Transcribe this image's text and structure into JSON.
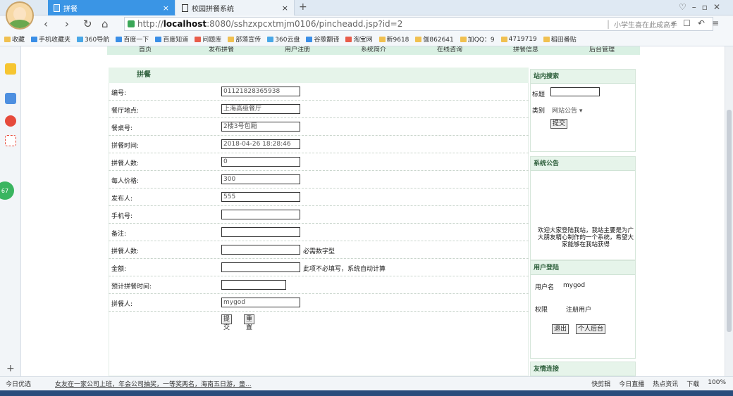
{
  "browser": {
    "tab_active": "拼餐",
    "tab_inactive": "校园拼餐系统",
    "url_protocol": "http://",
    "url_host": "localhost",
    "url_rest": ":8080/sshzxpcxtmjm0106/pincheadd.jsp?id=2",
    "search_hint": "小学生喜在此成高手",
    "favorites": [
      "收藏",
      "手机收藏夹",
      "360导航",
      "百度一下",
      "百度知道",
      "问题库",
      "部落宣传",
      "360云盘",
      "谷歌翻译",
      "淘宝网",
      "新9618",
      "伽862641",
      "加QQ：9",
      "4719719",
      "稻田番贴"
    ],
    "status_today": "今日优选",
    "status_news": "女友在一家公司上班，年会公司抽奖，一等奖两名，海南五日游，童...",
    "status_tools": [
      "快剪辑",
      "今日直播",
      "热点资讯",
      "下载",
      "100%"
    ],
    "sidebar_badge": "67"
  },
  "nav": [
    "首页",
    "发布拼餐",
    "用户注册",
    "系统简介",
    "在线咨询",
    "拼餐信息",
    "后台管理"
  ],
  "form": {
    "title": "拼餐",
    "fields": [
      {
        "label": "编号:",
        "value": "01121828365938"
      },
      {
        "label": "餐厅地点:",
        "value": "上海高级餐厅"
      },
      {
        "label": "餐桌号:",
        "value": "2楼3号包厢"
      },
      {
        "label": "拼餐时间:",
        "value": "2018-04-26 18:28:46"
      },
      {
        "label": "拼餐人数:",
        "value": "0"
      },
      {
        "label": "每人价格:",
        "value": "300"
      },
      {
        "label": "发布人:",
        "value": "555"
      },
      {
        "label": "手机号:",
        "value": ""
      },
      {
        "label": "备注:",
        "value": ""
      },
      {
        "label": "拼餐人数:",
        "value": "",
        "note": "必需数字型"
      },
      {
        "label": "金额:",
        "value": "",
        "note": "此项不必填写，系统自动计算"
      },
      {
        "label": "预计拼餐时间:",
        "value": ""
      },
      {
        "label": "拼餐人:",
        "value": "mygod"
      }
    ],
    "submit": "提交",
    "reset": "重置"
  },
  "search_panel": {
    "title": "站内搜索",
    "title_label": "标题",
    "category_label": "类别",
    "category_value": "网站公告",
    "submit": "提交"
  },
  "notice_panel": {
    "title": "系统公告",
    "text": "欢迎大家登陆我站，我站主要是为广大朋友精心制作的一个系统，希望大家能够在我站获得"
  },
  "login_panel": {
    "title": "用户登陆",
    "user_label": "用户名",
    "user_value": "mygod",
    "role_label": "权限",
    "role_value": "注册用户",
    "logout": "退出",
    "backend": "个人后台"
  },
  "links_panel": {
    "title": "友情连接"
  }
}
